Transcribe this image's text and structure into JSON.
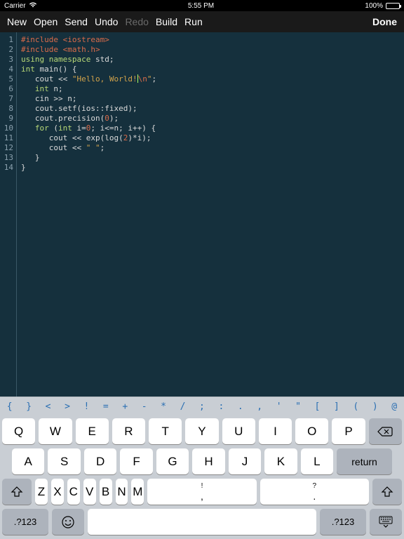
{
  "status": {
    "carrier": "Carrier",
    "time": "5:55 PM",
    "battery": "100%"
  },
  "toolbar": {
    "new": "New",
    "open": "Open",
    "send": "Send",
    "undo": "Undo",
    "redo": "Redo",
    "build": "Build",
    "run": "Run",
    "done": "Done"
  },
  "code": {
    "lines": [
      "1",
      "2",
      "3",
      "4",
      "5",
      "6",
      "7",
      "8",
      "9",
      "10",
      "11",
      "12",
      "13",
      "14"
    ],
    "l1": "#include <iostream>",
    "l2": "#include <math.h>",
    "l3a": "using",
    "l3b": "namespace",
    "l3c": " std;",
    "l4a": "int",
    "l4b": " main() {",
    "l5a": "   cout << ",
    "l5b": "\"Hello, World!",
    "l5c": "\\n",
    "l5d": "\"",
    "l5e": ";",
    "l6a": "   ",
    "l6b": "int",
    "l6c": " n;",
    "l7": "   cin >> n;",
    "l8": "   cout.setf(ios::fixed);",
    "l9a": "   cout.precision(",
    "l9b": "0",
    "l9c": ");",
    "l10a": "   ",
    "l10b": "for",
    "l10c": " (",
    "l10d": "int",
    "l10e": " i=",
    "l10f": "0",
    "l10g": "; i<=n; i++) {",
    "l11a": "      cout << exp(log(",
    "l11b": "2",
    "l11c": ")*i);",
    "l12a": "      cout << ",
    "l12b": "\" \"",
    "l12c": ";",
    "l13": "   }",
    "l14": "}"
  },
  "symbols": [
    "{",
    "}",
    "<",
    ">",
    "!",
    "=",
    "+",
    "-",
    "*",
    "/",
    ";",
    ":",
    ".",
    ",",
    "'",
    "\"",
    "[",
    "]",
    "(",
    ")",
    "@"
  ],
  "keys": {
    "row1": [
      "Q",
      "W",
      "E",
      "R",
      "T",
      "Y",
      "U",
      "I",
      "O",
      "P"
    ],
    "row2": [
      "A",
      "S",
      "D",
      "F",
      "G",
      "H",
      "J",
      "K",
      "L"
    ],
    "row3": [
      "Z",
      "X",
      "C",
      "V",
      "B",
      "N",
      "M"
    ],
    "p1top": "!",
    "p1bot": ",",
    "p2top": "?",
    "p2bot": ".",
    "return": "return",
    "mode": ".?123"
  }
}
